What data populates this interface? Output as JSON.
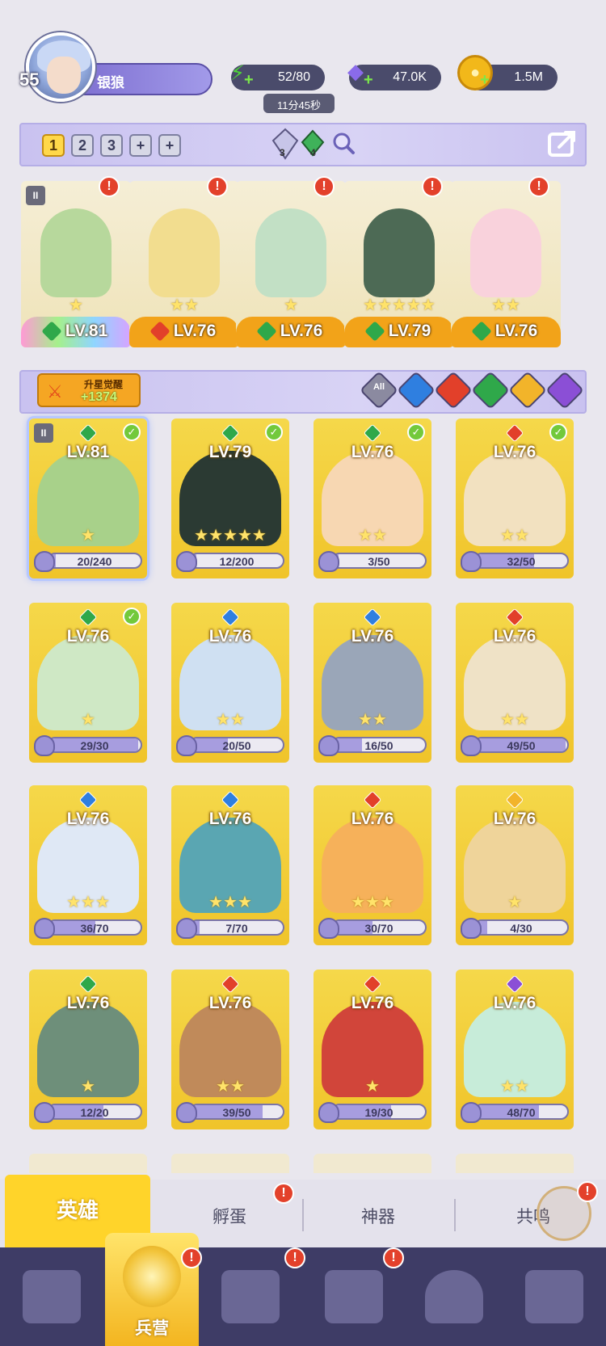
{
  "player": {
    "level": "55",
    "name": "银狼"
  },
  "resources": {
    "energy": {
      "value": "52/80",
      "timer": "11分45秒",
      "color": "#4fd23a"
    },
    "gems": {
      "value": "47.0K",
      "color": "#8a6bea"
    },
    "gold": {
      "value": "1.5M",
      "color": "#f2b81a"
    }
  },
  "team_tabs": [
    "1",
    "2",
    "3",
    "+",
    "+"
  ],
  "team_counters": {
    "water_gem": "3",
    "green_gem": "4"
  },
  "team": [
    {
      "level": "LV.81",
      "element": "wind",
      "stars": "★",
      "rank": "II"
    },
    {
      "level": "LV.76",
      "element": "fire",
      "stars": "★★"
    },
    {
      "level": "LV.76",
      "element": "wind",
      "stars": "★"
    },
    {
      "level": "LV.79",
      "element": "wind",
      "stars": "★★★★★"
    },
    {
      "level": "LV.76",
      "element": "wind",
      "stars": "★★"
    }
  ],
  "awaken": {
    "label": "升星觉醒",
    "value": "+1374"
  },
  "filters": {
    "all_label": "All",
    "elements": [
      "water",
      "fire",
      "wind",
      "light",
      "dark"
    ]
  },
  "element_colors": {
    "wind": "#2fa84a",
    "fire": "#e2402a",
    "water": "#2f7fe0",
    "light": "#f2b42a",
    "dark": "#8b4fd6"
  },
  "heroes": [
    {
      "level": "LV.81",
      "element": "wind",
      "shards": "20/240",
      "fill": 0.08,
      "stars": "★",
      "checked": true,
      "selected": true,
      "rank": "II"
    },
    {
      "level": "LV.79",
      "element": "wind",
      "shards": "12/200",
      "fill": 0.06,
      "stars": "★★★★★",
      "checked": true
    },
    {
      "level": "LV.76",
      "element": "wind",
      "shards": "3/50",
      "fill": 0.06,
      "stars": "★★",
      "checked": true
    },
    {
      "level": "LV.76",
      "element": "fire",
      "shards": "32/50",
      "fill": 0.64,
      "stars": "★★",
      "checked": true
    },
    {
      "level": "LV.76",
      "element": "wind",
      "shards": "29/30",
      "fill": 0.97,
      "stars": "★",
      "checked": true
    },
    {
      "level": "LV.76",
      "element": "water",
      "shards": "20/50",
      "fill": 0.4,
      "stars": "★★"
    },
    {
      "level": "LV.76",
      "element": "water",
      "shards": "16/50",
      "fill": 0.32,
      "stars": "★★"
    },
    {
      "level": "LV.76",
      "element": "fire",
      "shards": "49/50",
      "fill": 0.98,
      "stars": "★★"
    },
    {
      "level": "LV.76",
      "element": "water",
      "shards": "36/70",
      "fill": 0.51,
      "stars": "★★★"
    },
    {
      "level": "LV.76",
      "element": "water",
      "shards": "7/70",
      "fill": 0.1,
      "stars": "★★★"
    },
    {
      "level": "LV.76",
      "element": "fire",
      "shards": "30/70",
      "fill": 0.43,
      "stars": "★★★"
    },
    {
      "level": "LV.76",
      "element": "light",
      "shards": "4/30",
      "fill": 0.13,
      "stars": "★"
    },
    {
      "level": "LV.76",
      "element": "wind",
      "shards": "12/20",
      "fill": 0.6,
      "stars": "★"
    },
    {
      "level": "LV.76",
      "element": "fire",
      "shards": "39/50",
      "fill": 0.78,
      "stars": "★★"
    },
    {
      "level": "LV.76",
      "element": "fire",
      "shards": "19/30",
      "fill": 0.63,
      "stars": "★"
    },
    {
      "level": "LV.76",
      "element": "dark",
      "shards": "48/70",
      "fill": 0.69,
      "stars": "★★"
    }
  ],
  "subtabs": {
    "active": "英雄",
    "hatch": "孵蛋",
    "artifact": "神器",
    "resonance": "共鸣"
  },
  "bottom_nav": {
    "barracks": "兵营"
  }
}
